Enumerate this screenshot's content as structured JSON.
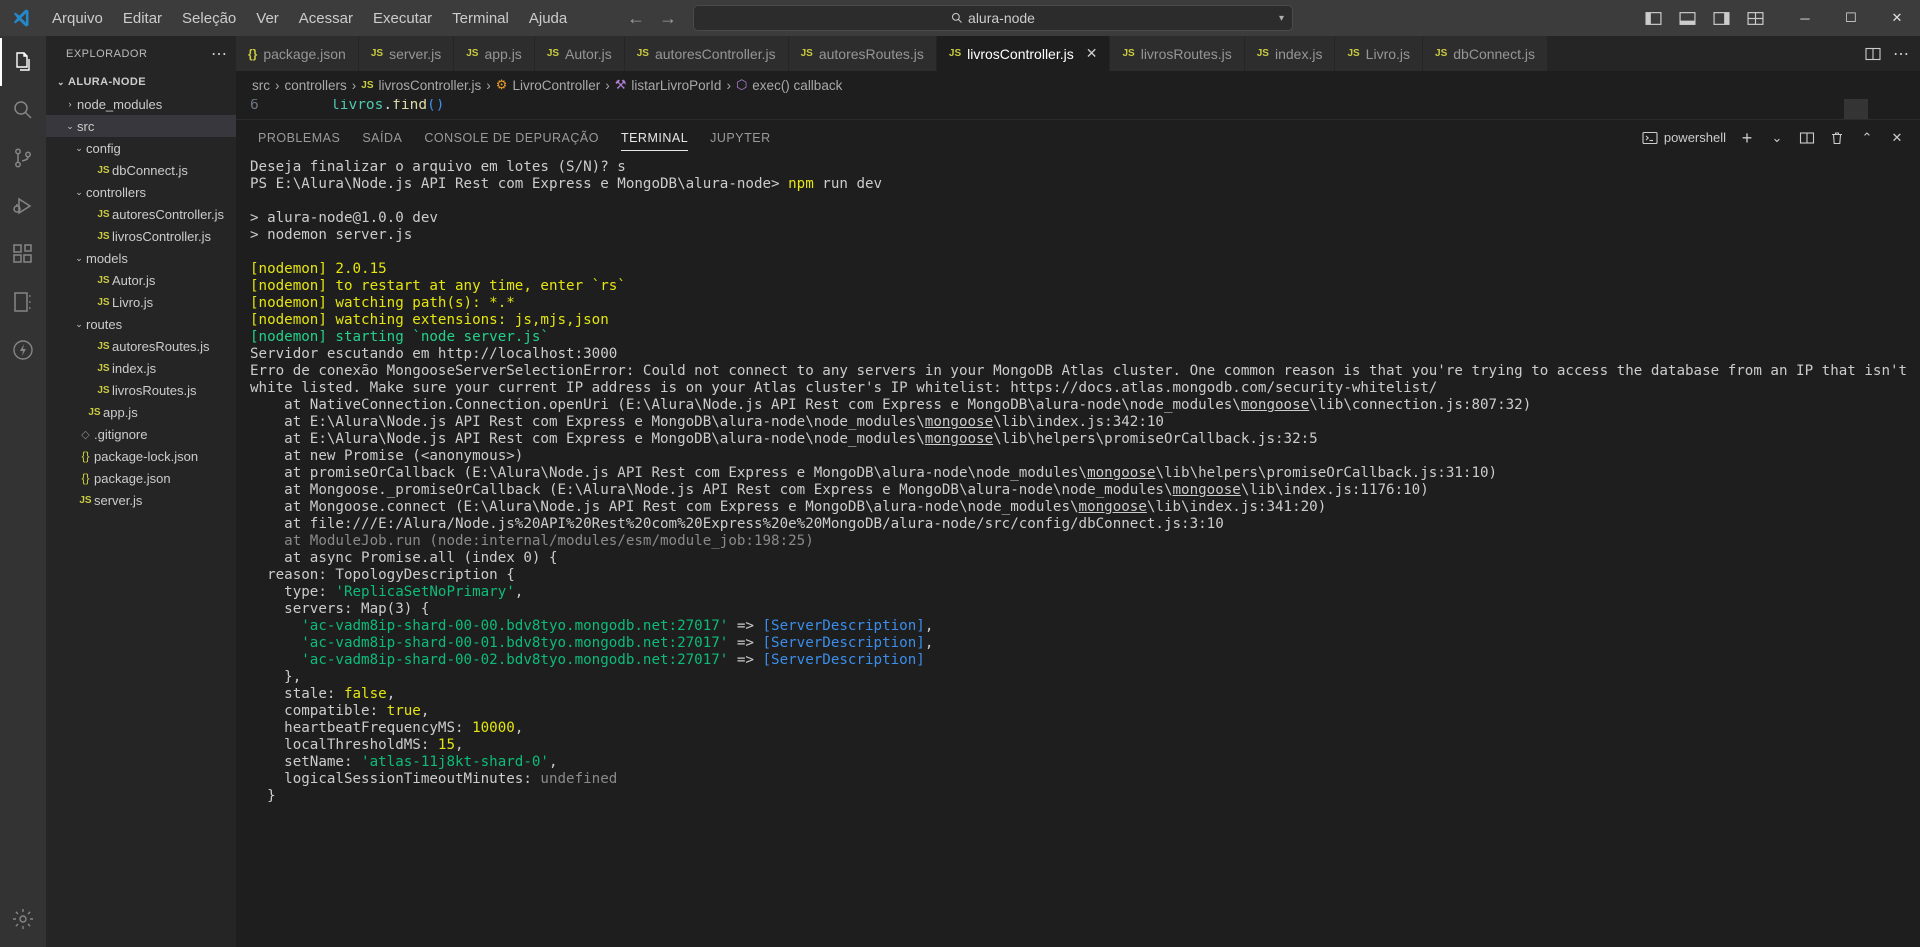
{
  "titlebar": {
    "menu": [
      "Arquivo",
      "Editar",
      "Seleção",
      "Ver",
      "Acessar",
      "Executar",
      "Terminal",
      "Ajuda"
    ],
    "search_value": "alura-node",
    "search_icon": "search-icon",
    "back_icon": "arrow-left-icon",
    "forward_icon": "arrow-right-icon",
    "layout_icons": [
      "toggle-primary-sidebar-icon",
      "toggle-panel-icon",
      "toggle-secondary-sidebar-icon",
      "customize-layout-icon"
    ],
    "window_minimize": "─",
    "window_maximize": "☐",
    "window_close": "✕"
  },
  "activitybar": {
    "items": [
      {
        "name": "explorer",
        "icon": "files-icon",
        "active": true
      },
      {
        "name": "search",
        "icon": "search-icon",
        "active": false
      },
      {
        "name": "source-control",
        "icon": "source-control-icon",
        "active": false
      },
      {
        "name": "run-and-debug",
        "icon": "debug-icon",
        "active": false
      },
      {
        "name": "extensions",
        "icon": "extensions-icon",
        "active": false
      },
      {
        "name": "jupyter",
        "icon": "notebook-icon",
        "active": false
      },
      {
        "name": "thunder-client",
        "icon": "thunder-icon",
        "active": false
      }
    ],
    "bottom": [
      {
        "name": "manage",
        "icon": "gear-icon"
      }
    ]
  },
  "sidebar": {
    "title": "EXPLORADOR",
    "more_actions": "⋯",
    "tree": [
      {
        "label": "ALURA-NODE",
        "indent": 0,
        "kind": "root",
        "twist": "⌄",
        "selected": false
      },
      {
        "label": "node_modules",
        "indent": 1,
        "kind": "folder",
        "twist": "›",
        "selected": false
      },
      {
        "label": "src",
        "indent": 1,
        "kind": "folder",
        "twist": "⌄",
        "selected": true
      },
      {
        "label": "config",
        "indent": 2,
        "kind": "folder",
        "twist": "⌄",
        "selected": false
      },
      {
        "label": "dbConnect.js",
        "indent": 3,
        "kind": "js",
        "twist": "",
        "selected": false
      },
      {
        "label": "controllers",
        "indent": 2,
        "kind": "folder",
        "twist": "⌄",
        "selected": false
      },
      {
        "label": "autoresController.js",
        "indent": 3,
        "kind": "js",
        "twist": "",
        "selected": false
      },
      {
        "label": "livrosController.js",
        "indent": 3,
        "kind": "js",
        "twist": "",
        "selected": false
      },
      {
        "label": "models",
        "indent": 2,
        "kind": "folder",
        "twist": "⌄",
        "selected": false
      },
      {
        "label": "Autor.js",
        "indent": 3,
        "kind": "js",
        "twist": "",
        "selected": false
      },
      {
        "label": "Livro.js",
        "indent": 3,
        "kind": "js",
        "twist": "",
        "selected": false
      },
      {
        "label": "routes",
        "indent": 2,
        "kind": "folder",
        "twist": "⌄",
        "selected": false
      },
      {
        "label": "autoresRoutes.js",
        "indent": 3,
        "kind": "js",
        "twist": "",
        "selected": false
      },
      {
        "label": "index.js",
        "indent": 3,
        "kind": "js",
        "twist": "",
        "selected": false
      },
      {
        "label": "livrosRoutes.js",
        "indent": 3,
        "kind": "js",
        "twist": "",
        "selected": false
      },
      {
        "label": "app.js",
        "indent": 2,
        "kind": "js",
        "twist": "",
        "selected": false
      },
      {
        "label": ".gitignore",
        "indent": 1,
        "kind": "git",
        "twist": "",
        "selected": false
      },
      {
        "label": "package-lock.json",
        "indent": 1,
        "kind": "json",
        "twist": "",
        "selected": false
      },
      {
        "label": "package.json",
        "indent": 1,
        "kind": "json",
        "twist": "",
        "selected": false
      },
      {
        "label": "server.js",
        "indent": 1,
        "kind": "js",
        "twist": "",
        "selected": false
      }
    ]
  },
  "editor": {
    "tabs": [
      {
        "label": "package.json",
        "kind": "json",
        "active": false,
        "closable": false
      },
      {
        "label": "server.js",
        "kind": "js",
        "active": false,
        "closable": false
      },
      {
        "label": "app.js",
        "kind": "js",
        "active": false,
        "closable": false
      },
      {
        "label": "Autor.js",
        "kind": "js",
        "active": false,
        "closable": false
      },
      {
        "label": "autoresController.js",
        "kind": "js",
        "active": false,
        "closable": false
      },
      {
        "label": "autoresRoutes.js",
        "kind": "js",
        "active": false,
        "closable": false
      },
      {
        "label": "livrosController.js",
        "kind": "js",
        "active": true,
        "closable": true
      },
      {
        "label": "livrosRoutes.js",
        "kind": "js",
        "active": false,
        "closable": false
      },
      {
        "label": "index.js",
        "kind": "js",
        "active": false,
        "closable": false
      },
      {
        "label": "Livro.js",
        "kind": "js",
        "active": false,
        "closable": false
      },
      {
        "label": "dbConnect.js",
        "kind": "js",
        "active": false,
        "closable": false
      }
    ],
    "tab_close_glyph": "✕",
    "split_editor_icon": "split-editor-icon",
    "more_actions": "⋯",
    "breadcrumb": [
      {
        "label": "src",
        "icon": ""
      },
      {
        "label": "controllers",
        "icon": ""
      },
      {
        "label": "livrosController.js",
        "icon": "js-file-icon"
      },
      {
        "label": "LivroController",
        "icon": "class-icon"
      },
      {
        "label": "listarLivroPorId",
        "icon": "method-icon"
      },
      {
        "label": "exec() callback",
        "icon": "object-icon"
      }
    ],
    "breadcrumb_sep": "›",
    "code_peek": {
      "line_number": "6",
      "text": "livros.find()"
    }
  },
  "panel": {
    "tabs": [
      {
        "label": "PROBLEMAS",
        "active": false
      },
      {
        "label": "SAÍDA",
        "active": false
      },
      {
        "label": "CONSOLE DE DEPURAÇÃO",
        "active": false
      },
      {
        "label": "TERMINAL",
        "active": true
      },
      {
        "label": "JUPYTER",
        "active": false
      }
    ],
    "shell_name": "powershell",
    "shell_icon": "terminal-icon",
    "actions": [
      {
        "name": "new-terminal",
        "icon": "plus-icon",
        "glyph": "+"
      },
      {
        "name": "terminal-picker",
        "icon": "chevron-down-icon",
        "glyph": "⌄"
      },
      {
        "name": "split-terminal",
        "icon": "split-icon",
        "glyph": ""
      },
      {
        "name": "kill-terminal",
        "icon": "trash-icon",
        "glyph": ""
      },
      {
        "name": "maximize-panel",
        "icon": "chevron-up-icon",
        "glyph": "⌃"
      },
      {
        "name": "close-panel",
        "icon": "close-icon",
        "glyph": "✕"
      }
    ]
  },
  "terminal_output": [
    {
      "segments": [
        {
          "t": "Deseja finalizar o arquivo em lotes (S/N)? s",
          "c": "w"
        }
      ]
    },
    {
      "segments": [
        {
          "t": "PS E:\\Alura\\Node.js API Rest com Express e MongoDB\\alura-node> ",
          "c": "w"
        },
        {
          "t": "npm",
          "c": "y"
        },
        {
          "t": " run dev",
          "c": "w"
        }
      ]
    },
    {
      "segments": [
        {
          "t": "",
          "c": "w"
        }
      ]
    },
    {
      "segments": [
        {
          "t": "> alura-node@1.0.0 dev",
          "c": "w"
        }
      ]
    },
    {
      "segments": [
        {
          "t": "> nodemon server.js",
          "c": "w"
        }
      ]
    },
    {
      "segments": [
        {
          "t": "",
          "c": "w"
        }
      ]
    },
    {
      "segments": [
        {
          "t": "[nodemon] 2.0.15",
          "c": "y"
        }
      ]
    },
    {
      "segments": [
        {
          "t": "[nodemon] to restart at any time, enter `rs`",
          "c": "y"
        }
      ]
    },
    {
      "segments": [
        {
          "t": "[nodemon] watching path(s): *.*",
          "c": "y"
        }
      ]
    },
    {
      "segments": [
        {
          "t": "[nodemon] watching extensions: js,mjs,json",
          "c": "y"
        }
      ]
    },
    {
      "segments": [
        {
          "t": "[nodemon] starting `node server.js`",
          "c": "g"
        }
      ]
    },
    {
      "segments": [
        {
          "t": "Servidor escutando em http://localhost:3000",
          "c": "w"
        }
      ]
    },
    {
      "segments": [
        {
          "t": "Erro de conexão MongooseServerSelectionError: Could not connect to any servers in your MongoDB Atlas cluster. One common reason is that you're trying to access the database from an IP that isn't white listed. Make sure your current IP address is on your Atlas cluster's IP whitelist: https://docs.atlas.mongodb.com/security-whitelist/",
          "c": "w"
        }
      ]
    },
    {
      "segments": [
        {
          "t": "    at NativeConnection.Connection.openUri (E:\\Alura\\Node.js API Rest com Express e MongoDB\\alura-node\\node_modules\\",
          "c": "w"
        },
        {
          "t": "mongoose",
          "c": "w ul"
        },
        {
          "t": "\\lib\\connection.js:807:32)",
          "c": "w"
        }
      ]
    },
    {
      "segments": [
        {
          "t": "    at E:\\Alura\\Node.js API Rest com Express e MongoDB\\alura-node\\node_modules\\",
          "c": "w"
        },
        {
          "t": "mongoose",
          "c": "w ul"
        },
        {
          "t": "\\lib\\index.js:342:10",
          "c": "w"
        }
      ]
    },
    {
      "segments": [
        {
          "t": "    at E:\\Alura\\Node.js API Rest com Express e MongoDB\\alura-node\\node_modules\\",
          "c": "w"
        },
        {
          "t": "mongoose",
          "c": "w ul"
        },
        {
          "t": "\\lib\\helpers\\promiseOrCallback.js:32:5",
          "c": "w"
        }
      ]
    },
    {
      "segments": [
        {
          "t": "    at new Promise (<anonymous>)",
          "c": "w"
        }
      ]
    },
    {
      "segments": [
        {
          "t": "    at promiseOrCallback (E:\\Alura\\Node.js API Rest com Express e MongoDB\\alura-node\\node_modules\\",
          "c": "w"
        },
        {
          "t": "mongoose",
          "c": "w ul"
        },
        {
          "t": "\\lib\\helpers\\promiseOrCallback.js:31:10)",
          "c": "w"
        }
      ]
    },
    {
      "segments": [
        {
          "t": "    at Mongoose._promiseOrCallback (E:\\Alura\\Node.js API Rest com Express e MongoDB\\alura-node\\node_modules\\",
          "c": "w"
        },
        {
          "t": "mongoose",
          "c": "w ul"
        },
        {
          "t": "\\lib\\index.js:1176:10)",
          "c": "w"
        }
      ]
    },
    {
      "segments": [
        {
          "t": "    at Mongoose.connect (E:\\Alura\\Node.js API Rest com Express e MongoDB\\alura-node\\node_modules\\",
          "c": "w"
        },
        {
          "t": "mongoose",
          "c": "w ul"
        },
        {
          "t": "\\lib\\index.js:341:20)",
          "c": "w"
        }
      ]
    },
    {
      "segments": [
        {
          "t": "    at file:///E:/Alura/Node.js%20API%20Rest%20com%20Express%20e%20MongoDB/alura-node/src/config/dbConnect.js:3:10",
          "c": "w"
        }
      ]
    },
    {
      "segments": [
        {
          "t": "    at ModuleJob.run (node:internal/modules/esm/module_job:198:25)",
          "c": "dim"
        }
      ]
    },
    {
      "segments": [
        {
          "t": "    at async Promise.all (index 0) {",
          "c": "w"
        }
      ]
    },
    {
      "segments": [
        {
          "t": "  reason: TopologyDescription {",
          "c": "w"
        }
      ]
    },
    {
      "segments": [
        {
          "t": "    type: ",
          "c": "w"
        },
        {
          "t": "'ReplicaSetNoPrimary'",
          "c": "gd"
        },
        {
          "t": ",",
          "c": "w"
        }
      ]
    },
    {
      "segments": [
        {
          "t": "    servers: Map(3) {",
          "c": "w"
        }
      ]
    },
    {
      "segments": [
        {
          "t": "      ",
          "c": "w"
        },
        {
          "t": "'ac-vadm8ip-shard-00-00.bdv8tyo.mongodb.net:27017'",
          "c": "gd"
        },
        {
          "t": " => ",
          "c": "w"
        },
        {
          "t": "[ServerDescription]",
          "c": "b"
        },
        {
          "t": ",",
          "c": "w"
        }
      ]
    },
    {
      "segments": [
        {
          "t": "      ",
          "c": "w"
        },
        {
          "t": "'ac-vadm8ip-shard-00-01.bdv8tyo.mongodb.net:27017'",
          "c": "gd"
        },
        {
          "t": " => ",
          "c": "w"
        },
        {
          "t": "[ServerDescription]",
          "c": "b"
        },
        {
          "t": ",",
          "c": "w"
        }
      ]
    },
    {
      "segments": [
        {
          "t": "      ",
          "c": "w"
        },
        {
          "t": "'ac-vadm8ip-shard-00-02.bdv8tyo.mongodb.net:27017'",
          "c": "gd"
        },
        {
          "t": " => ",
          "c": "w"
        },
        {
          "t": "[ServerDescription]",
          "c": "b"
        }
      ]
    },
    {
      "segments": [
        {
          "t": "    },",
          "c": "w"
        }
      ]
    },
    {
      "segments": [
        {
          "t": "    stale: ",
          "c": "w"
        },
        {
          "t": "false",
          "c": "y"
        },
        {
          "t": ",",
          "c": "w"
        }
      ]
    },
    {
      "segments": [
        {
          "t": "    compatible: ",
          "c": "w"
        },
        {
          "t": "true",
          "c": "y"
        },
        {
          "t": ",",
          "c": "w"
        }
      ]
    },
    {
      "segments": [
        {
          "t": "    heartbeatFrequencyMS: ",
          "c": "w"
        },
        {
          "t": "10000",
          "c": "y"
        },
        {
          "t": ",",
          "c": "w"
        }
      ]
    },
    {
      "segments": [
        {
          "t": "    localThresholdMS: ",
          "c": "w"
        },
        {
          "t": "15",
          "c": "y"
        },
        {
          "t": ",",
          "c": "w"
        }
      ]
    },
    {
      "segments": [
        {
          "t": "    setName: ",
          "c": "w"
        },
        {
          "t": "'atlas-11j8kt-shard-0'",
          "c": "gd"
        },
        {
          "t": ",",
          "c": "w"
        }
      ]
    },
    {
      "segments": [
        {
          "t": "    logicalSessionTimeoutMinutes: ",
          "c": "w"
        },
        {
          "t": "undefined",
          "c": "dim"
        }
      ]
    },
    {
      "segments": [
        {
          "t": "  }",
          "c": "w"
        }
      ]
    }
  ],
  "colors": {
    "accent": "#007acc",
    "titlebar_bg": "#3c3c3c",
    "sidebar_bg": "#252526",
    "editor_bg": "#1e1e1e",
    "activitybar_bg": "#333333",
    "js_icon": "#cbcb41",
    "terminal_yellow": "#e5e510",
    "terminal_green": "#23d18b",
    "terminal_blue": "#3b8eea"
  }
}
